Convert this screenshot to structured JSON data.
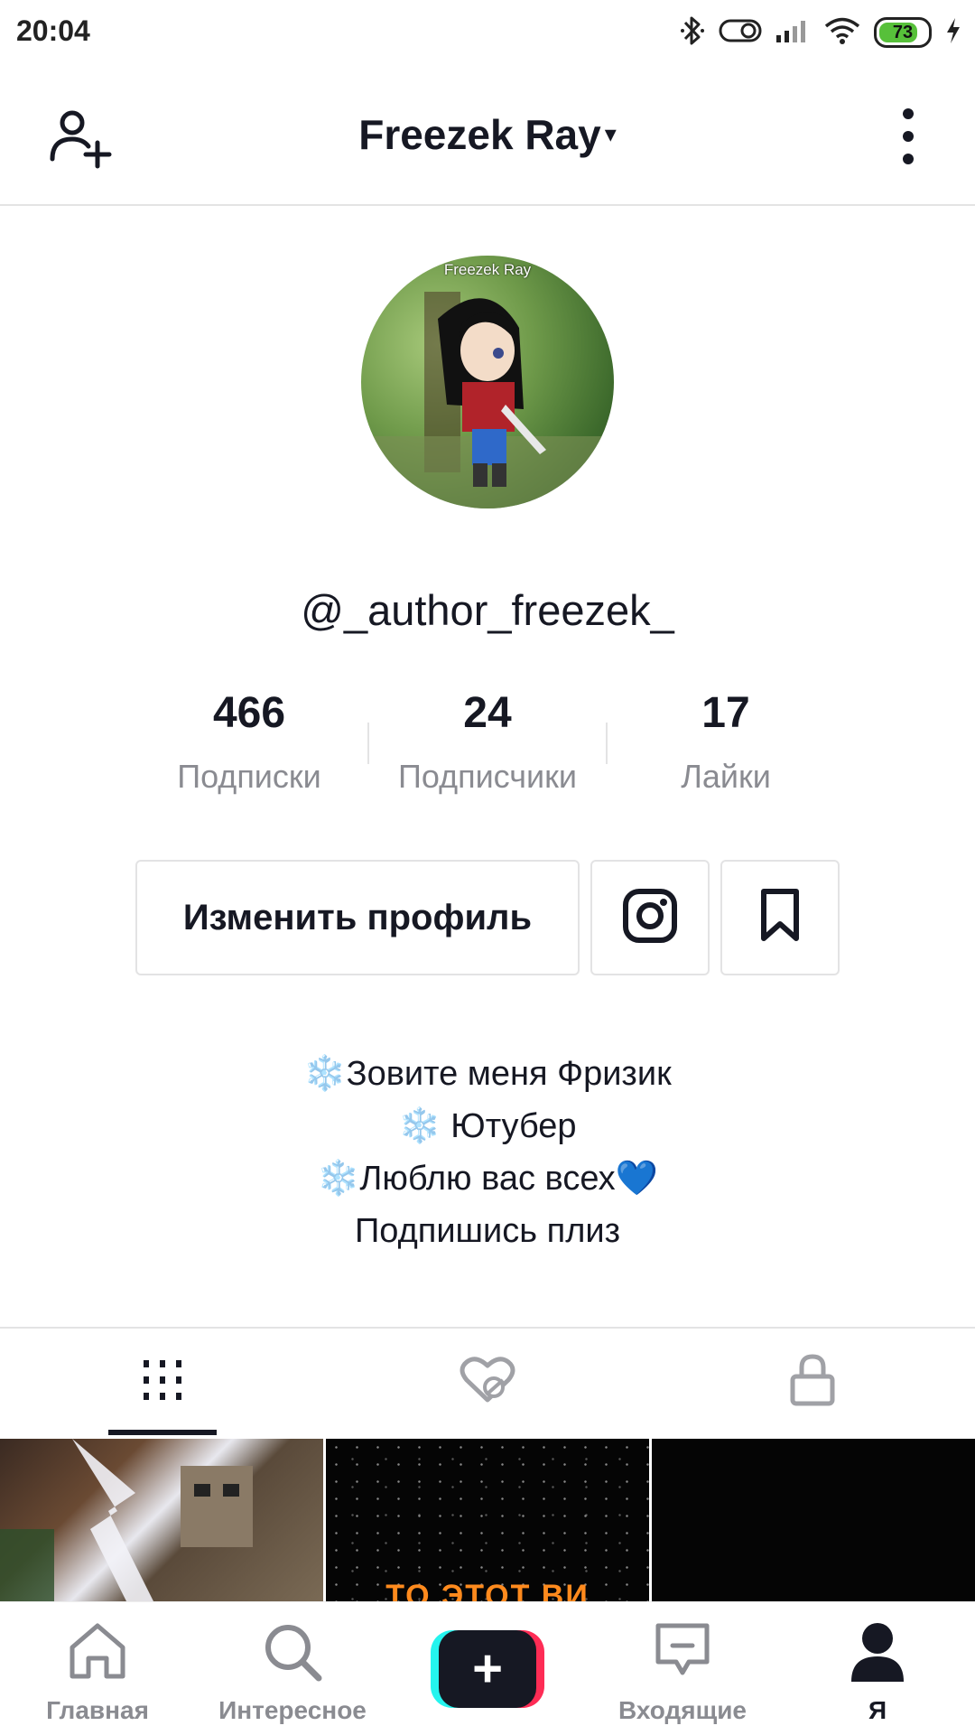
{
  "status_bar": {
    "time": "20:04",
    "battery": "73",
    "icons": [
      "bluetooth-icon",
      "toggle-icon",
      "signal-icon",
      "wifi-icon",
      "battery-icon",
      "charging-icon"
    ]
  },
  "header": {
    "title": "Freezek Ray",
    "caret": "▾",
    "left_icon": "add-person-icon",
    "right_icon": "more-vertical-icon"
  },
  "profile": {
    "avatar_caption": "Freezek Ray",
    "username": "@_author_freezek_"
  },
  "stats": [
    {
      "value": "466",
      "label": "Подписки"
    },
    {
      "value": "24",
      "label": "Подписчики"
    },
    {
      "value": "17",
      "label": "Лайки"
    }
  ],
  "buttons": {
    "edit_profile": "Изменить профиль",
    "instagram_icon": "instagram-icon",
    "favorites_icon": "bookmark-icon"
  },
  "bio": {
    "line1_emoji": "❄️",
    "line1_text": "Зовите меня Фризик",
    "line2_emoji": "❄️",
    "line2_text": " Ютубер",
    "line3_emoji": "❄️",
    "line3_text": "Люблю вас всех",
    "line3_heart": "💙",
    "line4_text": "Подпишись плиз"
  },
  "tabs": [
    {
      "name": "videos",
      "icon": "grid-icon",
      "active": true
    },
    {
      "name": "liked",
      "icon": "hidden-heart-icon",
      "active": false
    },
    {
      "name": "private",
      "icon": "lock-icon",
      "active": false
    }
  ],
  "grid": {
    "cell2_text": "ТО ЭТОТ ВИ"
  },
  "bottom_nav": [
    {
      "label": "Главная",
      "icon": "home-icon"
    },
    {
      "label": "Интересное",
      "icon": "search-icon"
    },
    {
      "label": "",
      "icon": "plus-icon"
    },
    {
      "label": "Входящие",
      "icon": "inbox-icon"
    },
    {
      "label": "Я",
      "icon": "profile-icon",
      "active": true
    }
  ],
  "colors": {
    "text": "#161823",
    "secondary": "#8a8b91",
    "divider": "#e3e3e4",
    "accent_cyan": "#25f4ee",
    "accent_red": "#fe2c55",
    "emoji_blue": "#3ea3e6"
  }
}
